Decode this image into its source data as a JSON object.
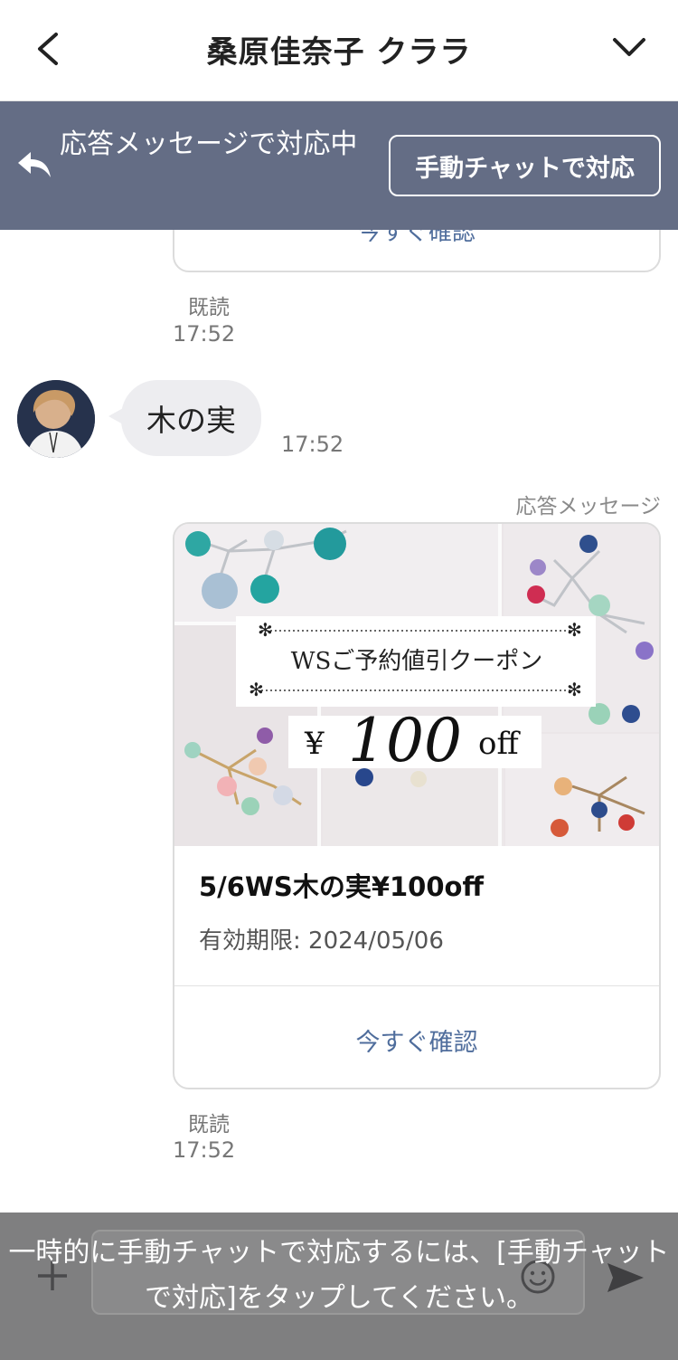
{
  "header": {
    "title": "桑原佳奈子 クララ"
  },
  "banner": {
    "status_text": "応答メッセージで対応中",
    "manual_button_label": "手動チャットで対応",
    "background_color": "#646d85"
  },
  "chat": {
    "previous_card": {
      "cut_text": "今すぐ確認"
    },
    "messages": [
      {
        "type": "status",
        "read_label": "既読",
        "time": "17:52"
      },
      {
        "type": "incoming",
        "text": "木の実",
        "time": "17:52"
      },
      {
        "type": "coupon",
        "source_label": "応答メッセージ",
        "image": {
          "headline": "WSご予約値引クーポン",
          "amount": "¥ 100 off",
          "currency": "¥",
          "number": "100",
          "suffix": "off"
        },
        "title": "5/6WS木の実¥100off",
        "expiry": "有効期限: 2024/05/06",
        "link_label": "今すぐ確認"
      },
      {
        "type": "status",
        "read_label": "既読",
        "time": "17:52"
      }
    ]
  },
  "bottom_bar": {
    "notice": "一時的に手動チャットで対応するには、[手動チャットで対応]をタップしてください。",
    "icons": [
      "plus-icon",
      "emoji-icon",
      "send-icon"
    ]
  },
  "colors": {
    "link": "#4f6d9c",
    "bubble": "#ededf0",
    "bottom_overlay": "#7f7f80"
  }
}
